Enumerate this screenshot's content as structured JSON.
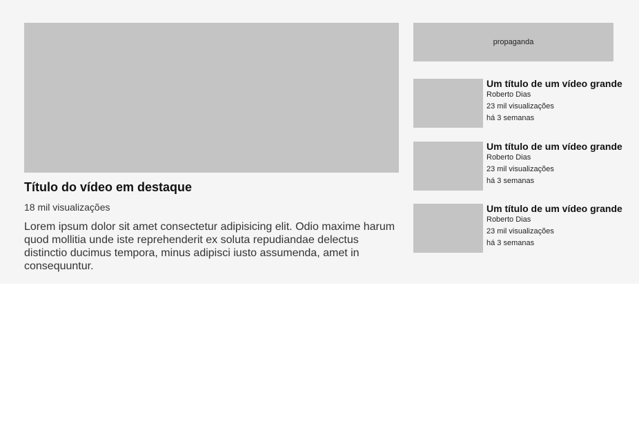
{
  "featured": {
    "title": "Título do vídeo em destaque",
    "views": "18 mil visualizações",
    "description": "Lorem ipsum dolor sit amet consectetur adipisicing elit. Odio maxime harum quod mollitia unde iste reprehenderit ex soluta repudiandae delectus distinctio ducimus tempora, minus adipisci iusto assumenda, amet in consequuntur."
  },
  "ad": {
    "label": "propaganda"
  },
  "videos": [
    {
      "title": "Um título de um vídeo grande",
      "channel": "Roberto Dias",
      "views": "23 mil visualizações",
      "age": "há 3 semanas"
    },
    {
      "title": "Um título de um vídeo grande",
      "channel": "Roberto Dias",
      "views": "23 mil visualizações",
      "age": "há 3 semanas"
    },
    {
      "title": "Um título de um vídeo grande",
      "channel": "Roberto Dias",
      "views": "23 mil visualizações",
      "age": "há 3 semanas"
    }
  ],
  "colors": {
    "section_background": "#f5f5f5",
    "placeholder": "#c4c4c4",
    "page_background": "#ffffff"
  }
}
